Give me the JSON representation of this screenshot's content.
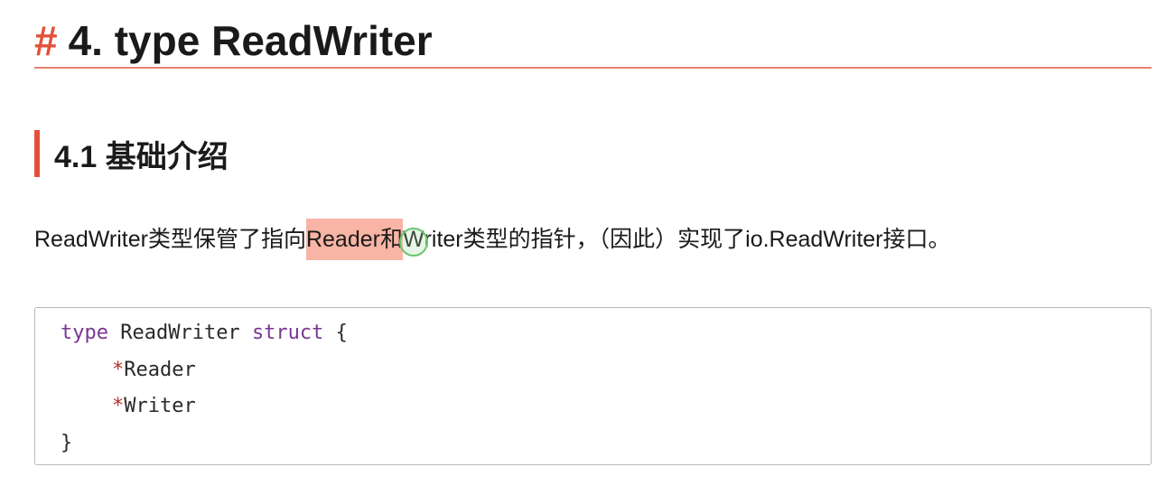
{
  "heading1": {
    "hash": "#",
    "text": "4. type ReadWriter"
  },
  "heading2": {
    "text": "4.1 基础介绍"
  },
  "paragraph": {
    "before": "ReadWriter类型保管了指向",
    "highlight": "Reader和",
    "cursor_char": "W",
    "after": "riter类型的指针，（因此）实现了io.ReadWriter接口。"
  },
  "code": {
    "line1": {
      "kw1": "type",
      "ident": " ReadWriter ",
      "kw2": "struct",
      "brace": " {"
    },
    "line2": {
      "star": "*",
      "name": "Reader"
    },
    "line3": {
      "star": "*",
      "name": "Writer"
    },
    "line4": {
      "brace": "}"
    }
  },
  "colors": {
    "accent": "#e4513a",
    "highlight": "#f8b4a4",
    "keyword": "#7b3593",
    "pointer": "#b0322a"
  }
}
